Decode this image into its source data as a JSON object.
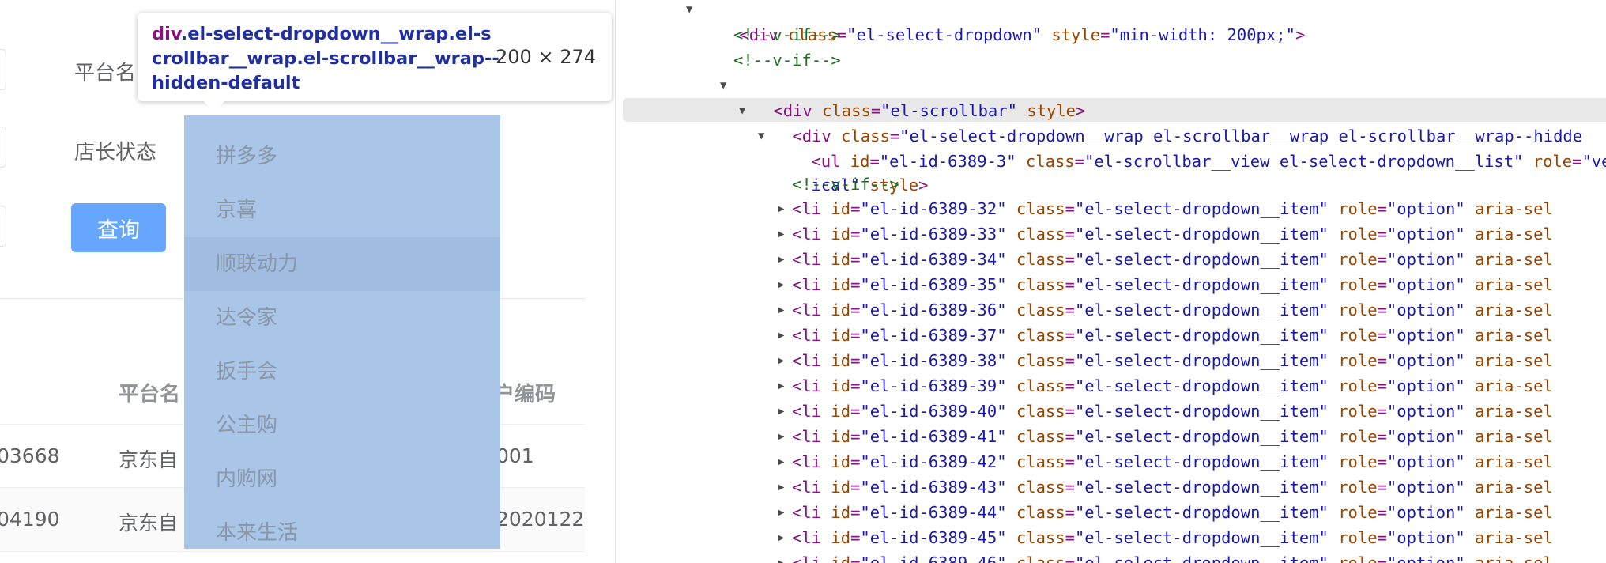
{
  "form": {
    "platform_label": "平台名",
    "shop_status_label": "店长状态",
    "query_button": "查询"
  },
  "table": {
    "headers": [
      "平台名",
      "户编码"
    ],
    "rows": [
      {
        "code": "03668",
        "platform": "京东自",
        "account": "001"
      },
      {
        "code": "04190",
        "platform": "京东自",
        "account": "2020122"
      }
    ]
  },
  "dropdown": {
    "items": [
      "拼多多",
      "京喜",
      "顺联动力",
      "达令家",
      "扳手会",
      "公主购",
      "内购网",
      "本来生活"
    ],
    "hovered_index": 2
  },
  "tooltip": {
    "tag": "div",
    "classes": ".el-select-dropdown__wrap.el-scrollbar__wrap.el-scrollbar__wrap--hidden-default",
    "size": "200 × 274"
  },
  "devtools": {
    "line0": {
      "tag": "div",
      "attr1": "class",
      "val1": "el-select-dropdown",
      "attr2": "style",
      "val2": "min-width: 200px;"
    },
    "comment1": "<!--v-if-->",
    "comment2": "<!--v-if-->",
    "line3": {
      "tag": "div",
      "attr1": "class",
      "val1": "el-scrollbar",
      "attr2": "style"
    },
    "line4": {
      "tag": "div",
      "attr1": "class",
      "val1": "el-select-dropdown__wrap el-scrollbar__wrap el-scrollbar__wrap--hidde"
    },
    "line5": {
      "tag": "ul",
      "attr1": "id",
      "val1": "el-id-6389-3",
      "attr2": "class",
      "val2": "el-scrollbar__view el-select-dropdown__list",
      "attr3": "role",
      "val3": "\"ver"
    },
    "line5b": {
      "val": "ical\"",
      "attr": "style"
    },
    "comment3": "<!--v-if-->",
    "li_items": [
      "el-id-6389-32",
      "el-id-6389-33",
      "el-id-6389-34",
      "el-id-6389-35",
      "el-id-6389-36",
      "el-id-6389-37",
      "el-id-6389-38",
      "el-id-6389-39",
      "el-id-6389-40",
      "el-id-6389-41",
      "el-id-6389-42",
      "el-id-6389-43",
      "el-id-6389-44",
      "el-id-6389-45",
      "el-id-6389-46"
    ],
    "li_class": "el-select-dropdown__item",
    "li_role": "option",
    "li_trunc_attr": "aria-sel"
  }
}
